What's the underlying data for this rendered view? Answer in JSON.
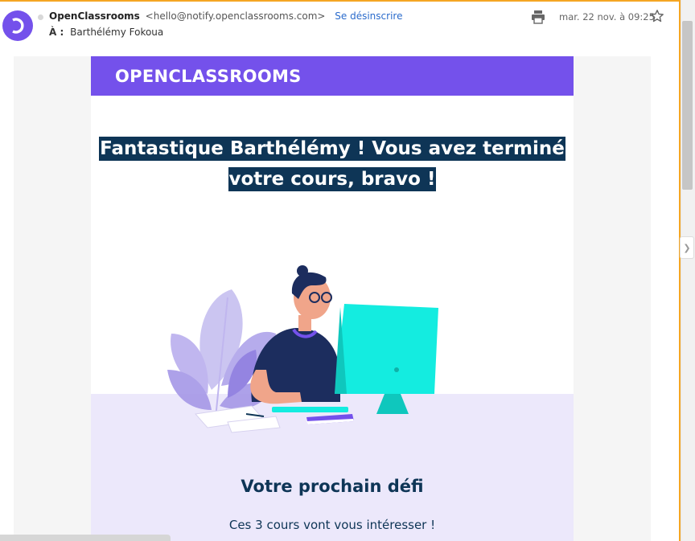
{
  "header": {
    "sender_name": "OpenClassrooms",
    "sender_email": "<hello@notify.openclassrooms.com>",
    "unsubscribe_label": "Se désinscrire",
    "to_label": "À :",
    "recipient": "Barthélémy Fokoua",
    "date": "mar. 22 nov. à 09:25",
    "icons": [
      "avatar-logo-icon",
      "print-icon",
      "star-icon"
    ]
  },
  "email": {
    "brand_logo": "OPENCLASSROOMS",
    "headline_line1": "Fantastique Barthélémy ! Vous avez terminé",
    "headline_line2": "votre cours, bravo !",
    "section_title": "Votre prochain défi",
    "section_subtitle": "Ces 3 cours vont vous intéresser !"
  },
  "colors": {
    "brand_purple": "#7451eb",
    "headline_highlight": "#0e3556",
    "lavender_bg": "#ece8fb",
    "accent_border": "#f5a623",
    "link_blue": "#2a6bcc"
  }
}
